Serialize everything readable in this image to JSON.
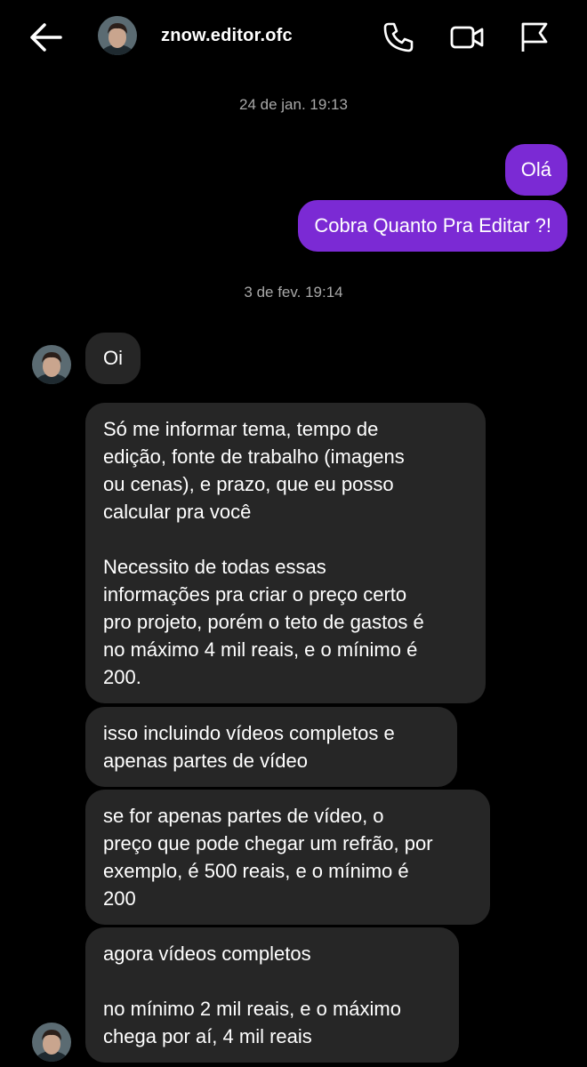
{
  "header": {
    "username": "znow.editor.ofc",
    "icons": [
      "back-arrow-icon",
      "phone-icon",
      "video-camera-icon",
      "flag-icon"
    ]
  },
  "timestamps": [
    "24 de jan. 19:13",
    "3 de fev. 19:14"
  ],
  "messages": {
    "out": [
      "Olá",
      "Cobra Quanto Pra Editar ?!"
    ],
    "in": [
      "Oi",
      "Só me informar tema, tempo de\nedição, fonte de trabalho (imagens\nou cenas), e prazo, que eu posso\ncalcular pra você\n\nNecessito de todas essas\ninformações pra criar o preço certo\npro projeto, porém o teto de gastos é\nno máximo 4 mil reais, e o mínimo é\n200.",
      "isso incluindo vídeos completos e\napenas partes de vídeo",
      "se for apenas partes de vídeo, o\npreço que pode chegar um refrão, por\nexemplo, é 500 reais, e o mínimo é\n200",
      "agora vídeos completos\n\nno mínimo 2 mil reais, e o máximo\nchega por aí, 4 mil reais"
    ]
  },
  "colors": {
    "background": "#000000",
    "outgoing": "#7b2ad4",
    "incoming": "#262626",
    "timestamp": "#a8a8a8"
  }
}
